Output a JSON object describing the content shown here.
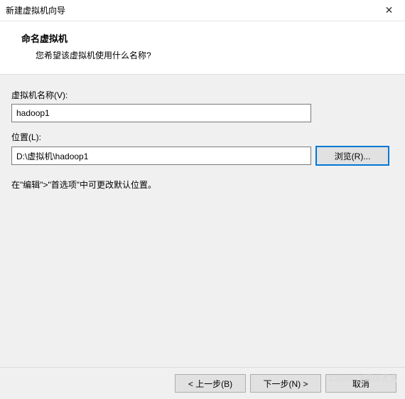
{
  "window": {
    "title": "新建虚拟机向导",
    "close_glyph": "✕"
  },
  "header": {
    "title": "命名虚拟机",
    "subtitle": "您希望该虚拟机使用什么名称?"
  },
  "form": {
    "name_label": "虚拟机名称(V):",
    "name_value": "hadoop1",
    "location_label": "位置(L):",
    "location_value": "D:\\虚拟机\\hadoop1",
    "browse_label": "浏览(R)...",
    "hint": "在\"编辑\">\"首选项\"中可更改默认位置。"
  },
  "footer": {
    "back_label": "< 上一步(B)",
    "next_label": "下一步(N) >",
    "cancel_label": "取消"
  },
  "watermark": "CSDN @诺IX无言"
}
